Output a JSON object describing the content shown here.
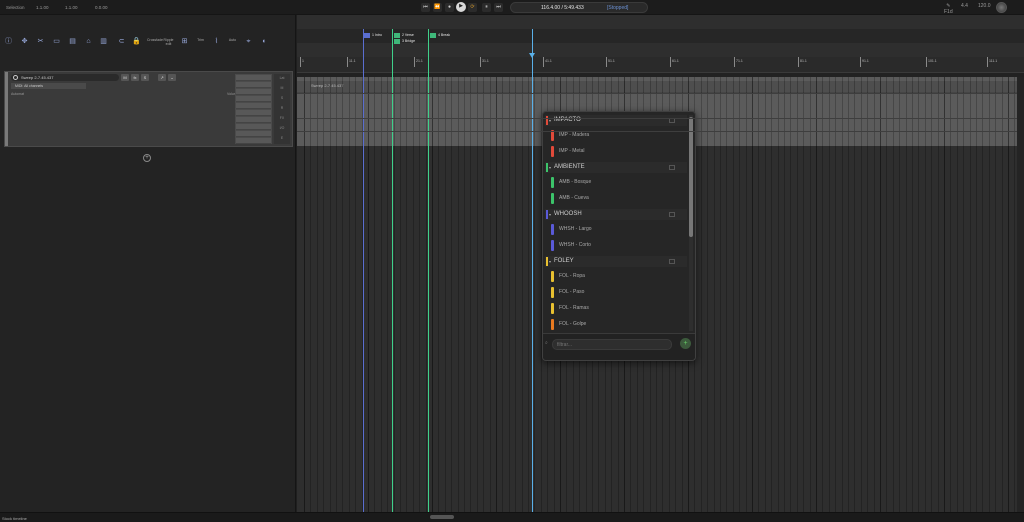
{
  "topbar": {
    "selection_label": "Selection",
    "sel_start": "1.1.00",
    "sel_end": "1.1.00",
    "sel_length": "0.0.00",
    "time_display": "116.4.00 / 5:49.433",
    "time_status": "[Stopped]",
    "right_icons": [
      "pen-icon",
      "grid-icon",
      "sync-icon"
    ],
    "right_labels": [
      "F1d",
      "4.4",
      "120.0"
    ]
  },
  "toolbar": {
    "tools": [
      "info-icon",
      "move-tool",
      "cut-tool",
      "glue-tool",
      "clip-tool",
      "select-tool",
      "split-tool",
      "snap-tool",
      "lock-tool",
      "loop-tool"
    ],
    "text_tools": [
      "Crossfade",
      "Ripple edit",
      "Grid",
      "Trim",
      "Auto",
      "Tempo"
    ]
  },
  "track": {
    "name": "Sweep 2-7.45.437",
    "input": "MIDI: All channels",
    "sub_label": "Automat",
    "sub_label2": "Volume",
    "side_labels": [
      "Lat",
      "M",
      "S",
      "R",
      "FX",
      "I/O",
      "E"
    ]
  },
  "arrange": {
    "ruler_labels": [
      "1",
      "11.1",
      "21.1",
      "31.1",
      "41.1",
      "51.1",
      "61.1",
      "71.1",
      "81.1",
      "91.1",
      "101.1",
      "111.1",
      "121.1",
      "131.1"
    ],
    "markers": [
      {
        "label": "1 Intro",
        "color": "#5a6ed0"
      },
      {
        "label": "2 Verse",
        "color": "#3fb87a"
      },
      {
        "label": "3 Bridge",
        "color": "#3fb87a"
      },
      {
        "label": "4 Break",
        "color": "#3fb87a"
      }
    ],
    "clip_label": "Sweep 2-7.45.437"
  },
  "popup": {
    "filter_placeholder": "filtrar...",
    "add_label": "+",
    "categories": [
      {
        "name": "IMPACTO",
        "color": "#e04a3a",
        "items": [
          {
            "label": "IMP - Madera",
            "color": "#e04a3a"
          },
          {
            "label": "IMP - Metal",
            "color": "#e04a3a"
          }
        ]
      },
      {
        "name": "AMBIENTE",
        "color": "#3cc46a",
        "items": [
          {
            "label": "AMB - Bosque",
            "color": "#3cc46a"
          },
          {
            "label": "AMB - Cueva",
            "color": "#3cc46a"
          }
        ]
      },
      {
        "name": "WHOOSH",
        "color": "#5a5ad8",
        "items": [
          {
            "label": "WHSH - Largo",
            "color": "#5a5ad8"
          },
          {
            "label": "WHSH - Corto",
            "color": "#5a5ad8"
          }
        ]
      },
      {
        "name": "FOLEY",
        "color": "#e8c030",
        "items": [
          {
            "label": "FOL - Ropa",
            "color": "#e8c030"
          },
          {
            "label": "FOL - Paso",
            "color": "#e8c030"
          },
          {
            "label": "FOL - Ramas",
            "color": "#e8c030"
          },
          {
            "label": "FOL - Golpe",
            "color": "#e87a20"
          }
        ]
      }
    ]
  },
  "status": {
    "text": "Stock timeline"
  }
}
